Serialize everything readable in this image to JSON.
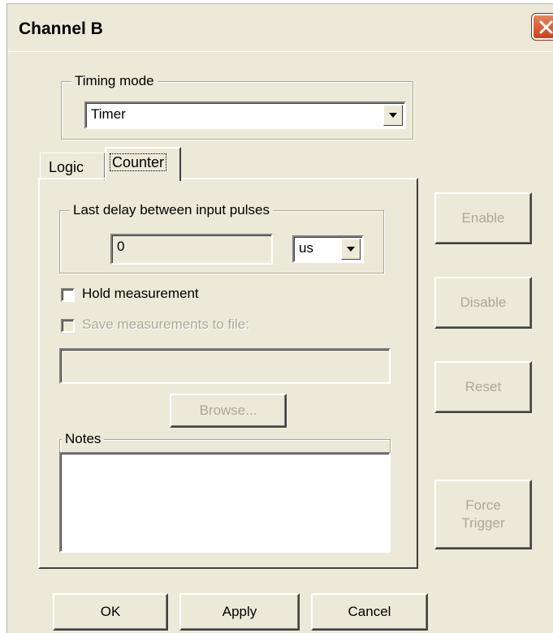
{
  "window": {
    "title": "Channel B"
  },
  "timing_mode": {
    "group_label": "Timing mode",
    "selected": "Timer"
  },
  "tabs": [
    {
      "label": "Logic",
      "active": false
    },
    {
      "label": "Counter",
      "active": true
    }
  ],
  "counter": {
    "delay_group_label": "Last delay between input pulses",
    "delay_value": "0",
    "unit_selected": "us",
    "hold_label": "Hold measurement",
    "hold_checked": false,
    "save_label": "Save measurements to file:",
    "save_enabled": false,
    "file_path": "",
    "browse_label": "Browse...",
    "notes_label": "Notes",
    "notes_text": ""
  },
  "side_buttons": {
    "enable": "Enable",
    "disable": "Disable",
    "reset": "Reset",
    "force_trigger": "Force\nTrigger"
  },
  "footer": {
    "ok": "OK",
    "apply": "Apply",
    "cancel": "Cancel"
  }
}
